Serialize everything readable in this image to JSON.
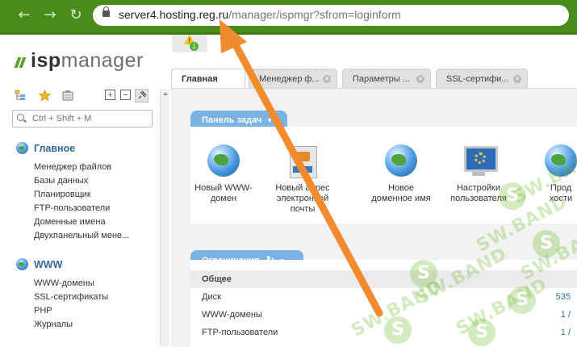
{
  "browser": {
    "url_host": "server4.hosting.reg.ru",
    "url_path": "/manager/ispmgr?sfrom=loginform"
  },
  "logo": {
    "prefix": "isp",
    "suffix": "manager"
  },
  "search": {
    "placeholder": "Ctrl + Shift + M"
  },
  "sidebar": {
    "sections": [
      {
        "title": "Главное",
        "items": [
          "Менеджер файлов",
          "Базы данных",
          "Планировщик",
          "FTP-пользователи",
          "Доменные имена",
          "Двухпанельный мене..."
        ]
      },
      {
        "title": "WWW",
        "items": [
          "WWW-домены",
          "SSL-сертификаты",
          "PHP",
          "Журналы"
        ]
      }
    ]
  },
  "notifications": {
    "count": "1"
  },
  "tabs": [
    {
      "label": "Главная",
      "active": true
    },
    {
      "label": "Менеджер ф...",
      "active": false
    },
    {
      "label": "Параметры ...",
      "active": false
    },
    {
      "label": "SSL-сертифи...",
      "active": false
    }
  ],
  "task_panel": {
    "title": "Панель задач",
    "tasks": [
      {
        "label": "Новый WWW-\nдомен",
        "icon": "globe-icon"
      },
      {
        "label": "Новый адрес\nэлектронной\nпочты",
        "icon": "mailbox-icon"
      },
      {
        "label": "Новое\nдоменное имя",
        "icon": "globe-doc-icon"
      },
      {
        "label": "Настройки\nпользователя",
        "icon": "monitor-settings-icon"
      },
      {
        "label": "Прод\nхости",
        "icon": "globe-icon"
      }
    ]
  },
  "limits": {
    "title": "Ограничения",
    "group": "Общее",
    "rows": [
      {
        "label": "Диск",
        "value": "535"
      },
      {
        "label": "WWW-домены",
        "value": "1 /"
      },
      {
        "label": "FTP-пользователи",
        "value": "1 /"
      }
    ]
  },
  "watermark": {
    "text": "SW.BAND",
    "letter": "S"
  },
  "colors": {
    "browser_green": "#4a8c1c",
    "accent_blue": "#7ab3e3",
    "arrow_orange": "#f28a2e"
  }
}
